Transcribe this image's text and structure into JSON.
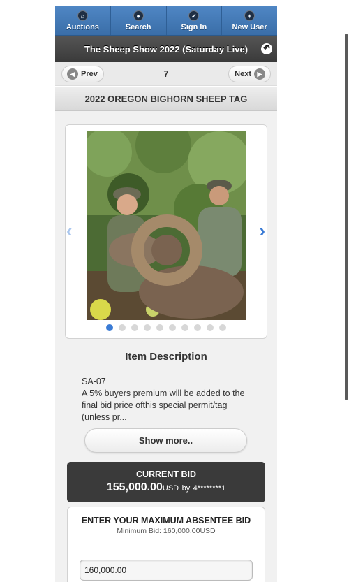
{
  "nav": {
    "items": [
      {
        "label": "Auctions",
        "icon": "home-icon"
      },
      {
        "label": "Search",
        "icon": "search-icon"
      },
      {
        "label": "Sign In",
        "icon": "checkmark-icon"
      },
      {
        "label": "New User",
        "icon": "plus-icon"
      }
    ]
  },
  "header": {
    "title": "The Sheep Show 2022 (Saturday Live)",
    "back_icon": "back-icon"
  },
  "pager": {
    "prev_label": "Prev",
    "next_label": "Next",
    "lot_number": "7"
  },
  "item": {
    "title": "2022 OREGON BIGHORN SHEEP TAG",
    "image_count": 10,
    "active_image_index": 0
  },
  "description": {
    "heading": "Item Description",
    "code": "SA-07",
    "text": "A 5% buyers premium will be added to the final bid price ofthis special permit/tag (unless pr...",
    "show_more_label": "Show more.."
  },
  "current_bid": {
    "label": "CURRENT BID",
    "amount": "155,000.00",
    "currency": "USD",
    "by_label": "by",
    "bidder": "4********1"
  },
  "absentee": {
    "title": "ENTER YOUR MAXIMUM ABSENTEE BID",
    "minimum": "Minimum Bid: 160,000.00USD",
    "input_value": "160,000.00"
  },
  "colors": {
    "nav_blue": "#3a6ea8",
    "accent": "#3a7bd5",
    "dark_bar": "#3a3a3a"
  }
}
